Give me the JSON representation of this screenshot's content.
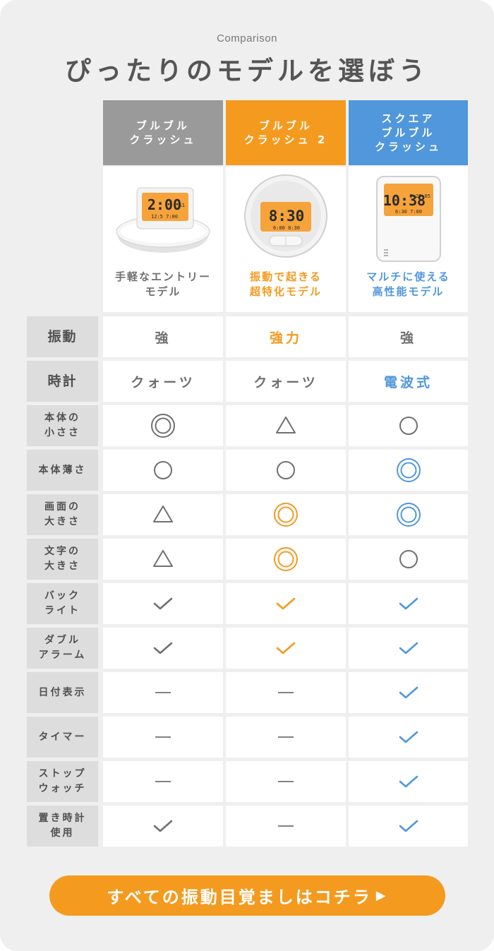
{
  "eyebrow": "Comparison",
  "title": "ぴったりのモデルを選ぼう",
  "colors": {
    "gray": "#707070",
    "orange": "#f49a1f",
    "blue": "#5097dc",
    "header_gray": "#9a9a9a",
    "label_bg": "#dddddd",
    "card_bg": "#efefef"
  },
  "products": [
    {
      "name": "ブルブル\nクラッシュ",
      "tagline": "手軽なエントリー\nモデル",
      "color": "gray",
      "display_time": "2:00",
      "display_small": "12:5 7:00",
      "display_side": "S1"
    },
    {
      "name": "ブルブル\nクラッシュ 2",
      "tagline": "振動で起きる\n超特化モデル",
      "color": "orange",
      "display_time": "8:30",
      "display_small": "6:00 8:30",
      "display_side": ""
    },
    {
      "name": "スクエア\nブルブル\nクラッシュ",
      "tagline": "マルチに使える\n高性能モデル",
      "color": "blue",
      "display_time": "10:38",
      "display_small": "6:30 7:00",
      "display_side": "5.26 05"
    }
  ],
  "rows": [
    {
      "label": "振動",
      "style": "big",
      "cells": [
        {
          "type": "text",
          "value": "強",
          "color": "gray"
        },
        {
          "type": "text",
          "value": "強力",
          "color": "orange"
        },
        {
          "type": "text",
          "value": "強",
          "color": "gray"
        }
      ]
    },
    {
      "label": "時計",
      "style": "big",
      "cells": [
        {
          "type": "text",
          "value": "クォーツ",
          "color": "gray"
        },
        {
          "type": "text",
          "value": "クォーツ",
          "color": "gray"
        },
        {
          "type": "text",
          "value": "電波式",
          "color": "blue"
        }
      ]
    },
    {
      "label": "本体の\n小ささ",
      "cells": [
        {
          "type": "double-circle",
          "color": "gray"
        },
        {
          "type": "triangle",
          "color": "gray"
        },
        {
          "type": "circle",
          "color": "gray"
        }
      ]
    },
    {
      "label": "本体薄さ",
      "cells": [
        {
          "type": "circle",
          "color": "gray"
        },
        {
          "type": "circle",
          "color": "gray"
        },
        {
          "type": "double-circle",
          "color": "blue"
        }
      ]
    },
    {
      "label": "画面の\n大きさ",
      "cells": [
        {
          "type": "triangle",
          "color": "gray"
        },
        {
          "type": "double-circle",
          "color": "orange"
        },
        {
          "type": "double-circle",
          "color": "blue"
        }
      ]
    },
    {
      "label": "文字の\n大きさ",
      "cells": [
        {
          "type": "triangle",
          "color": "gray"
        },
        {
          "type": "double-circle",
          "color": "orange"
        },
        {
          "type": "circle",
          "color": "gray"
        }
      ]
    },
    {
      "label": "バック\nライト",
      "cells": [
        {
          "type": "check",
          "color": "gray"
        },
        {
          "type": "check",
          "color": "orange"
        },
        {
          "type": "check",
          "color": "blue"
        }
      ]
    },
    {
      "label": "ダブル\nアラーム",
      "cells": [
        {
          "type": "check",
          "color": "gray"
        },
        {
          "type": "check",
          "color": "orange"
        },
        {
          "type": "check",
          "color": "blue"
        }
      ]
    },
    {
      "label": "日付表示",
      "cells": [
        {
          "type": "dash",
          "color": "gray"
        },
        {
          "type": "dash",
          "color": "gray"
        },
        {
          "type": "check",
          "color": "blue"
        }
      ]
    },
    {
      "label": "タイマー",
      "cells": [
        {
          "type": "dash",
          "color": "gray"
        },
        {
          "type": "dash",
          "color": "gray"
        },
        {
          "type": "check",
          "color": "blue"
        }
      ]
    },
    {
      "label": "ストップ\nウォッチ",
      "cells": [
        {
          "type": "dash",
          "color": "gray"
        },
        {
          "type": "dash",
          "color": "gray"
        },
        {
          "type": "check",
          "color": "blue"
        }
      ]
    },
    {
      "label": "置き時計\n使用",
      "cells": [
        {
          "type": "check",
          "color": "gray"
        },
        {
          "type": "dash",
          "color": "gray"
        },
        {
          "type": "check",
          "color": "blue"
        }
      ]
    }
  ],
  "cta": {
    "label": "すべての振動目覚ましはコチラ",
    "arrow": "▶"
  }
}
